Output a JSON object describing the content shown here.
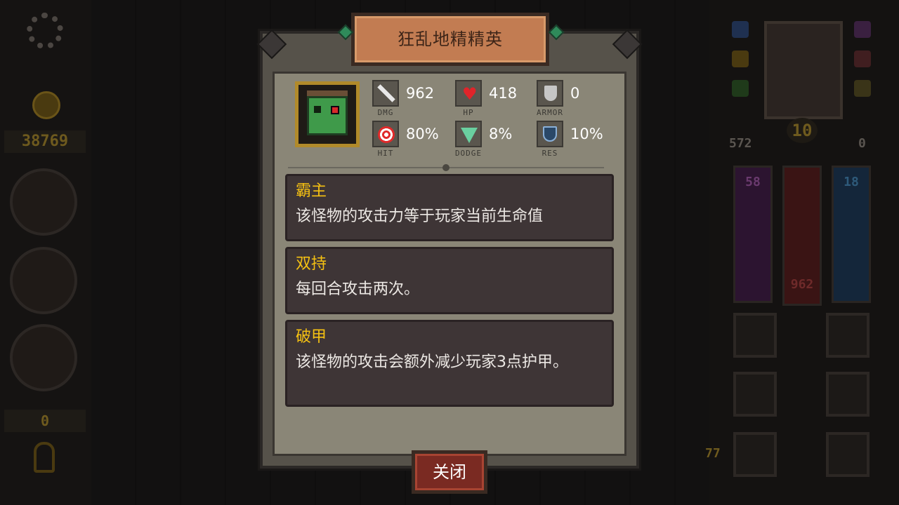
{
  "modal": {
    "title": "狂乱地精精英",
    "close_label": "关闭"
  },
  "stats": {
    "dmg": {
      "value": "962",
      "label": "DMG"
    },
    "hp": {
      "value": "418",
      "label": "HP"
    },
    "armor": {
      "value": "0",
      "label": "ARMOR"
    },
    "hit": {
      "value": "80%",
      "label": "HIT"
    },
    "dodge": {
      "value": "8%",
      "label": "DODGE"
    },
    "res": {
      "value": "10%",
      "label": "RES"
    }
  },
  "abilities": [
    {
      "name": "霸主",
      "description": "该怪物的攻击力等于玩家当前生命值"
    },
    {
      "name": "双持",
      "description": "每回合攻击两次。"
    },
    {
      "name": "破甲",
      "description": "该怪物的攻击会额外减少玩家3点护甲。"
    }
  ],
  "left_hud": {
    "gold": "38769",
    "keys": "0"
  },
  "right_hud": {
    "level": "10",
    "attack": "572",
    "defense": "0",
    "mana": "58",
    "health": "962",
    "energy": "18",
    "slot_counter": "77"
  },
  "colors": {
    "title_plate": "#c27c52",
    "ability_title": "#f5c112",
    "card_bg": "#3e3536",
    "frame": "#56524a",
    "close_button": "#7a2a22"
  },
  "icons": {
    "dmg": "sword-icon",
    "hp": "heart-icon",
    "armor": "shield-icon",
    "hit": "target-icon",
    "dodge": "tornado-icon",
    "res": "resistance-shield-icon"
  }
}
